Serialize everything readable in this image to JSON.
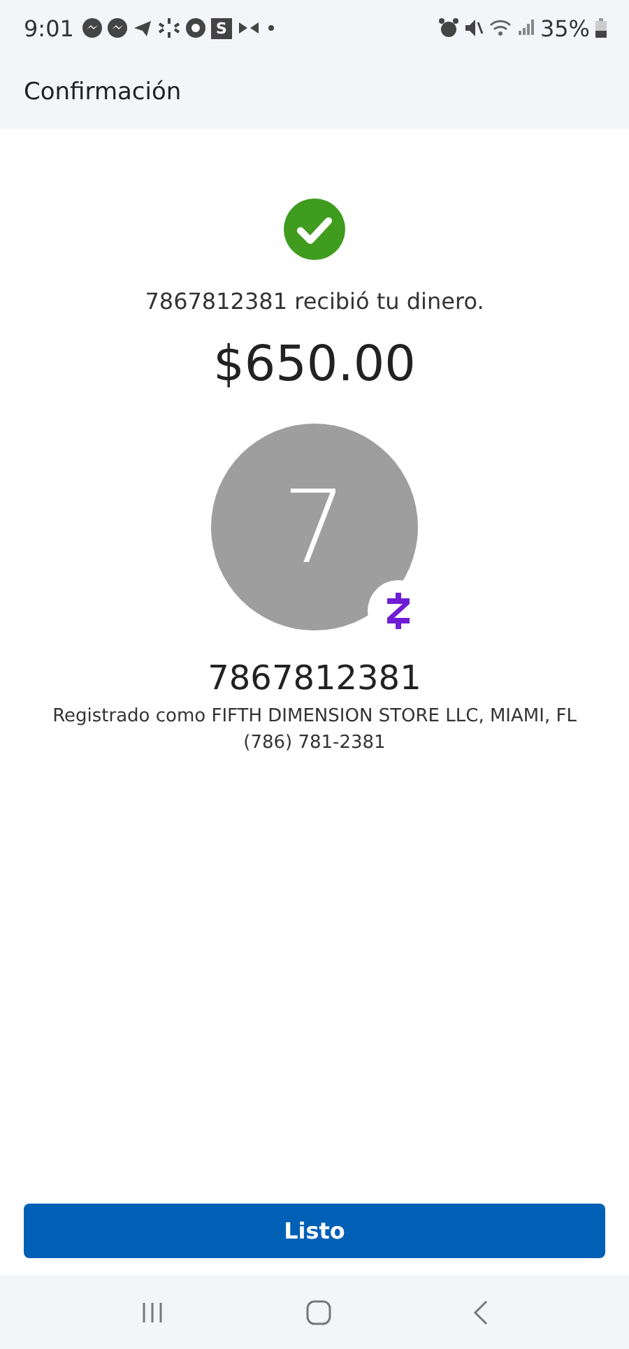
{
  "status_bar": {
    "time": "9:01",
    "app_badge": "S",
    "battery": "35%"
  },
  "header": {
    "title": "Confirmación"
  },
  "confirmation": {
    "message": "7867812381 recibió tu dinero.",
    "amount": "$650.00"
  },
  "recipient": {
    "initial": "7",
    "name": "7867812381",
    "registered": "Registrado como FIFTH DIMENSION STORE LLC, MIAMI, FL",
    "phone": "(786) 781-2381"
  },
  "button": {
    "label": "Listo"
  }
}
